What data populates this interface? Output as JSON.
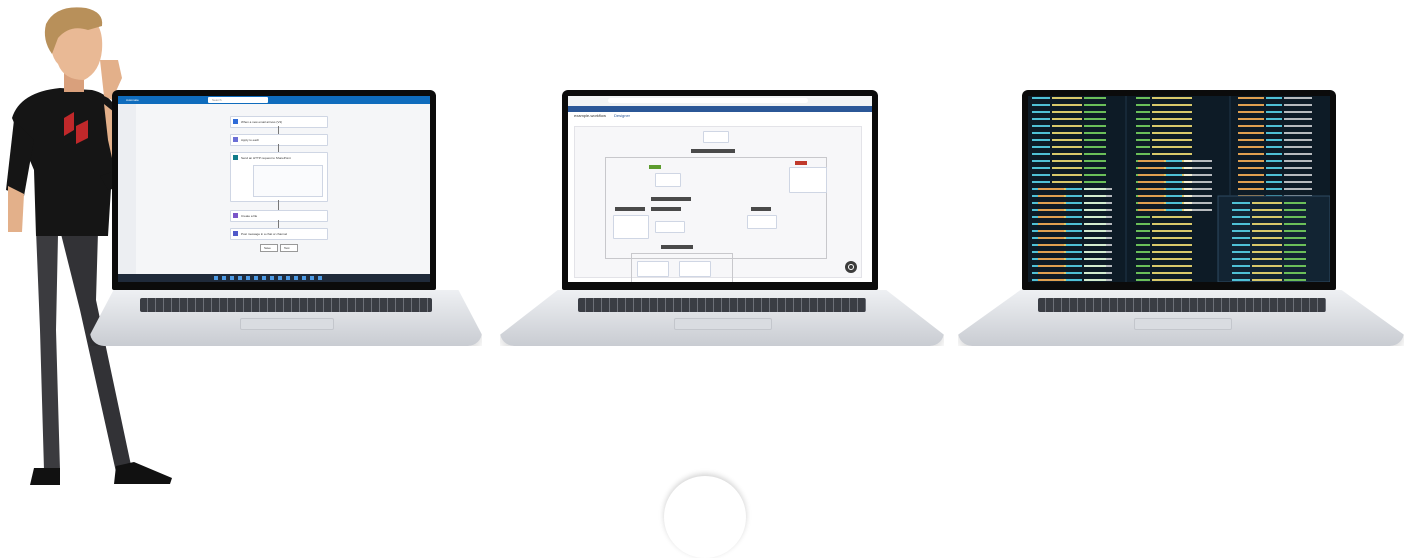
{
  "scene": {
    "laptop1": {
      "app_bar_title": "Automate",
      "search_placeholder": "Search",
      "step_labels": [
        "When a new email arrives (V3)",
        "Apply to each",
        "Send an HTTP request to SharePoint",
        "Create a file",
        "Post message in a chat or channel"
      ],
      "buttons": [
        "Save",
        "Test"
      ]
    },
    "laptop2": {
      "page_title": "example-workflow",
      "tab_label": "Designer",
      "node_labels": [
        "Start",
        "Condition",
        "True",
        "False",
        "Approval",
        "Task",
        "Switch",
        "Case",
        "Default"
      ]
    },
    "laptop3": {
      "editor": "code-editor"
    }
  },
  "colors": {
    "win_accent": "#0f6cbd",
    "flow_blue": "#2f6bd8",
    "code_bg": "#0d1b26",
    "code_cyan": "#4fc1d6",
    "code_yellow": "#d9c96a",
    "code_green": "#6bbf59",
    "code_orange": "#e0a050",
    "person_shirt": "#141414",
    "person_skin": "#e9b995",
    "person_hair": "#b8905a",
    "brand_red": "#c0282a"
  }
}
